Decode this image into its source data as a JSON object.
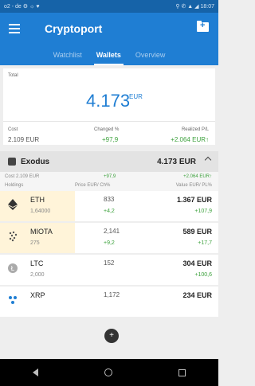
{
  "status_bar": {
    "left": "o2 - de ⚙ ☼ ♥",
    "right": "⚲ ✆ ▲ ◢ 18:07"
  },
  "app": {
    "title": "Cryptoport"
  },
  "tabs": [
    {
      "label": "Watchlist",
      "active": false
    },
    {
      "label": "Wallets",
      "active": true
    },
    {
      "label": "Overview",
      "active": false
    }
  ],
  "summary": {
    "total_label": "Total",
    "total_value": "4.173",
    "currency": "EUR",
    "cost_label": "Cost",
    "cost_value": "2.109 EUR",
    "changed_label": "Changed %",
    "changed_value": "+97,9",
    "realized_label": "Realized P/L",
    "realized_value": "+2.064 EUR↑"
  },
  "wallet": {
    "name": "Exodus",
    "total": "4.173 EUR",
    "cost": "Cost 2.109 EUR",
    "changed": "+97,9",
    "pl": "+2.064 EUR↑",
    "col_holdings": "Holdings",
    "col_price": "Price EUR/ Ch%",
    "col_value": "Value EUR/ PL%"
  },
  "coins": [
    {
      "symbol": "ETH",
      "amount": "1,64000",
      "price": "833",
      "change": "+4,2",
      "value": "1.367 EUR",
      "pl": "+107,9",
      "icon": "eth-icon"
    },
    {
      "symbol": "MIOTA",
      "amount": "275",
      "price": "2,141",
      "change": "+9,2",
      "value": "589 EUR",
      "pl": "+17,7",
      "icon": "iota-icon"
    },
    {
      "symbol": "LTC",
      "amount": "2,000",
      "price": "152",
      "change": "",
      "value": "304 EUR",
      "pl": "+100,6",
      "icon": "ltc-icon"
    },
    {
      "symbol": "XRP",
      "amount": "",
      "price": "1,172",
      "change": "",
      "value": "234 EUR",
      "pl": "",
      "icon": "xrp-icon"
    }
  ],
  "colors": {
    "primary": "#1f7ed3",
    "positive": "#3ca13c"
  }
}
